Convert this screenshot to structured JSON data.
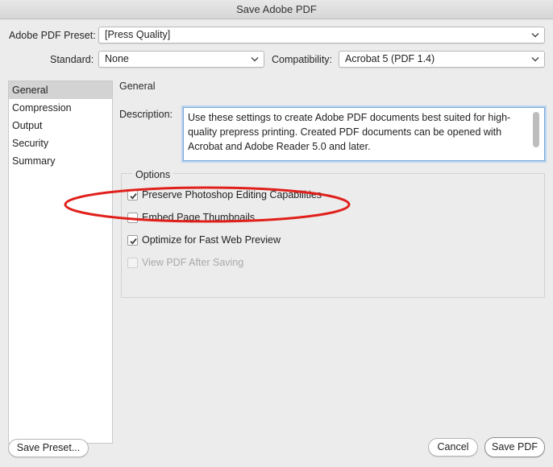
{
  "window": {
    "title": "Save Adobe PDF"
  },
  "preset": {
    "label": "Adobe PDF Preset:",
    "value": "[Press Quality]"
  },
  "standard": {
    "label": "Standard:",
    "value": "None"
  },
  "compatibility": {
    "label": "Compatibility:",
    "value": "Acrobat 5 (PDF 1.4)"
  },
  "sidebar": {
    "items": [
      {
        "label": "General",
        "selected": true
      },
      {
        "label": "Compression"
      },
      {
        "label": "Output"
      },
      {
        "label": "Security"
      },
      {
        "label": "Summary"
      }
    ]
  },
  "main": {
    "section_title": "General",
    "description_label": "Description:",
    "description_text": "Use these settings to create Adobe PDF documents best suited for high-quality prepress printing.  Created PDF documents can be opened with Acrobat and Adobe Reader 5.0 and later.",
    "options_title": "Options",
    "options": [
      {
        "label": "Preserve Photoshop Editing Capabilities",
        "checked": true,
        "enabled": true
      },
      {
        "label": "Embed Page Thumbnails",
        "checked": false,
        "enabled": true
      },
      {
        "label": "Optimize for Fast Web Preview",
        "checked": true,
        "enabled": true
      },
      {
        "label": "View PDF After Saving",
        "checked": false,
        "enabled": false
      }
    ]
  },
  "footer": {
    "save_preset_label": "Save Preset...",
    "cancel_label": "Cancel",
    "save_pdf_label": "Save PDF"
  },
  "annotation": {
    "color": "#e0201b"
  }
}
